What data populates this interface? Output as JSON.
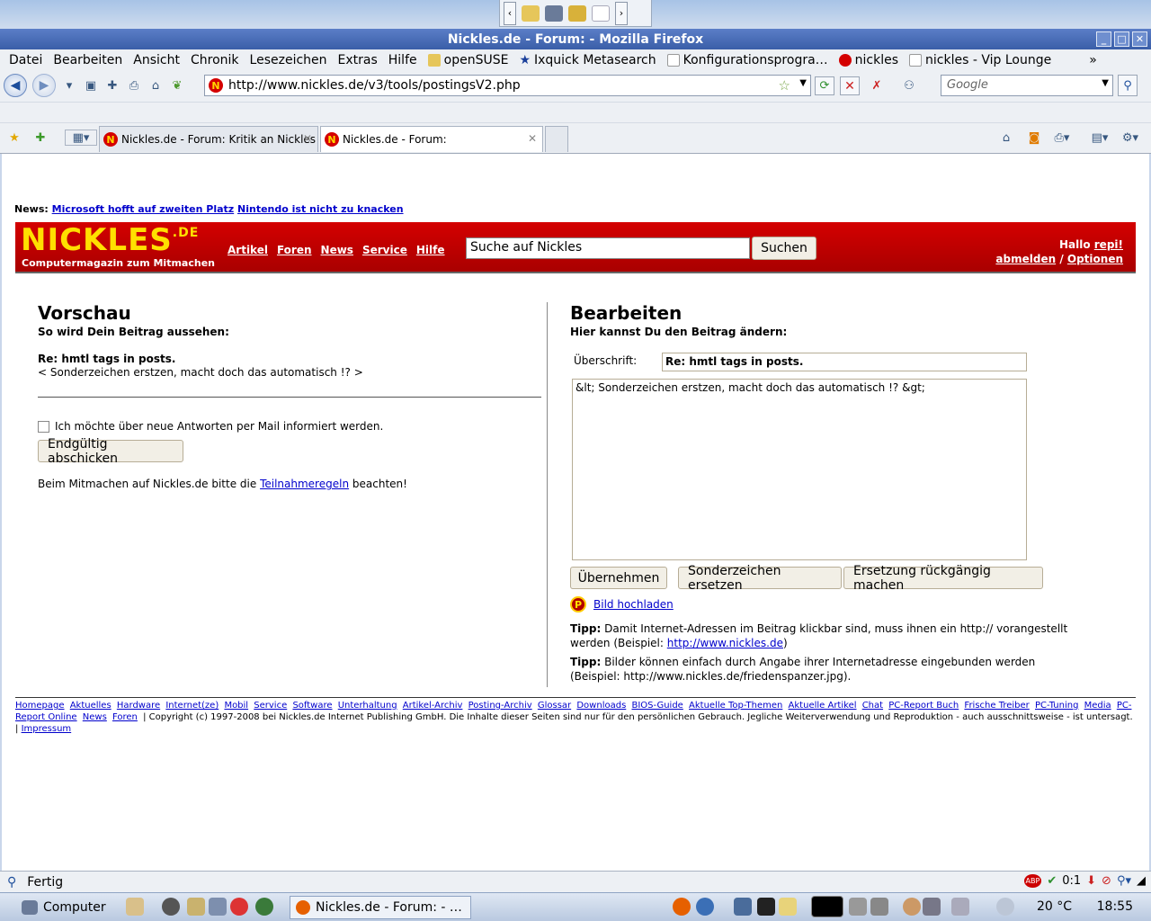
{
  "window": {
    "title": "Nickles.de - Forum: - Mozilla Firefox"
  },
  "menu": {
    "items": [
      "Datei",
      "Bearbeiten",
      "Ansicht",
      "Chronik",
      "Lesezeichen",
      "Extras",
      "Hilfe"
    ],
    "bookmarks": [
      "openSUSE",
      "Ixquick Metasearch",
      "Konfigurationsprogra…",
      "nickles",
      "nickles - Vip Lounge"
    ],
    "overflow": "»"
  },
  "nav": {
    "url": "http://www.nickles.de/v3/tools/postingsV2.php",
    "search_placeholder": "Google"
  },
  "tabs": [
    {
      "label": "Nickles.de - Forum: Kritik an Nickles"
    },
    {
      "label": "Nickles.de - Forum:"
    }
  ],
  "page": {
    "news_label": "News:",
    "news_links": [
      "Microsoft hofft auf zweiten Platz",
      "Nintendo ist nicht zu knacken"
    ],
    "logo": "NICKLES",
    "logo_suffix": ".DE",
    "tagline": "Computermagazin zum Mitmachen",
    "nav_links": [
      "Artikel",
      "Foren",
      "News",
      "Service",
      "Hilfe"
    ],
    "search_value": "Suche auf Nickles",
    "search_button": "Suchen",
    "greeting": "Hallo",
    "username": "repi!",
    "logout": "abmelden",
    "separator": "/",
    "options": "Optionen"
  },
  "preview": {
    "heading": "Vorschau",
    "subheading": "So wird Dein Beitrag aussehen:",
    "title": "Re: hmtl tags in posts.",
    "body": "< Sonderzeichen erstzen, macht doch das automatisch !? >",
    "notify_label": "Ich möchte über neue Antworten per Mail informiert werden.",
    "submit": "Endgültig abschicken",
    "rules_before": "Beim Mitmachen auf Nickles.de bitte die",
    "rules_link": "Teilnahmeregeln",
    "rules_after": "beachten!"
  },
  "edit": {
    "heading": "Bearbeiten",
    "subheading": "Hier kannst Du den Beitrag ändern:",
    "subject_label": "Überschrift:",
    "subject_value": "Re: hmtl tags in posts.",
    "body_value": "&lt; Sonderzeichen erstzen, macht doch das automatisch !? &gt;",
    "btn_apply": "Übernehmen",
    "btn_replace": "Sonderzeichen ersetzen",
    "btn_undo": "Ersetzung rückgängig machen",
    "upload_icon": "P",
    "upload_link": "Bild hochladen",
    "tip1_label": "Tipp:",
    "tip1_text": "Damit Internet-Adressen im Beitrag klickbar sind, muss ihnen ein http:// vorangestellt werden (Beispiel:",
    "tip1_link": "http://www.nickles.de",
    "tip1_end": ")",
    "tip2_label": "Tipp:",
    "tip2_text": "Bilder können einfach durch Angabe ihrer Internetadresse eingebunden werden (Beispiel: http://www.nickles.de/friedenspanzer.jpg)."
  },
  "footer": {
    "links": [
      "Homepage",
      "Aktuelles",
      "Hardware",
      "Internet(ze)",
      "Mobil",
      "Service",
      "Software",
      "Unterhaltung",
      "Artikel-Archiv",
      "Posting-Archiv",
      "Glossar",
      "Downloads",
      "BIOS-Guide",
      "Aktuelle Top-Themen",
      "Aktuelle Artikel",
      "Chat",
      "PC-Report Buch",
      "Frische Treiber",
      "PC-Tuning",
      "Media",
      "PC-Report Online",
      "News",
      "Foren"
    ],
    "copyright": "| Copyright (c) 1997-2008 bei Nickles.de Internet Publishing GmbH. Die Inhalte dieser Seiten sind nur für den persönlichen Gebrauch. Jegliche Weiterverwendung und Reproduktion - auch ausschnittsweise - ist untersagt. |",
    "impressum": "Impressum"
  },
  "status": {
    "text": "Fertig",
    "counter": "0:1"
  },
  "taskbar": {
    "computer": "Computer",
    "task": "Nickles.de - Forum: - …",
    "temperature": "20 °C",
    "clock": "18:55"
  },
  "colors": {
    "brand_red": "#c00000",
    "logo_yellow": "#ffe000",
    "link_blue": "#0000cc"
  }
}
